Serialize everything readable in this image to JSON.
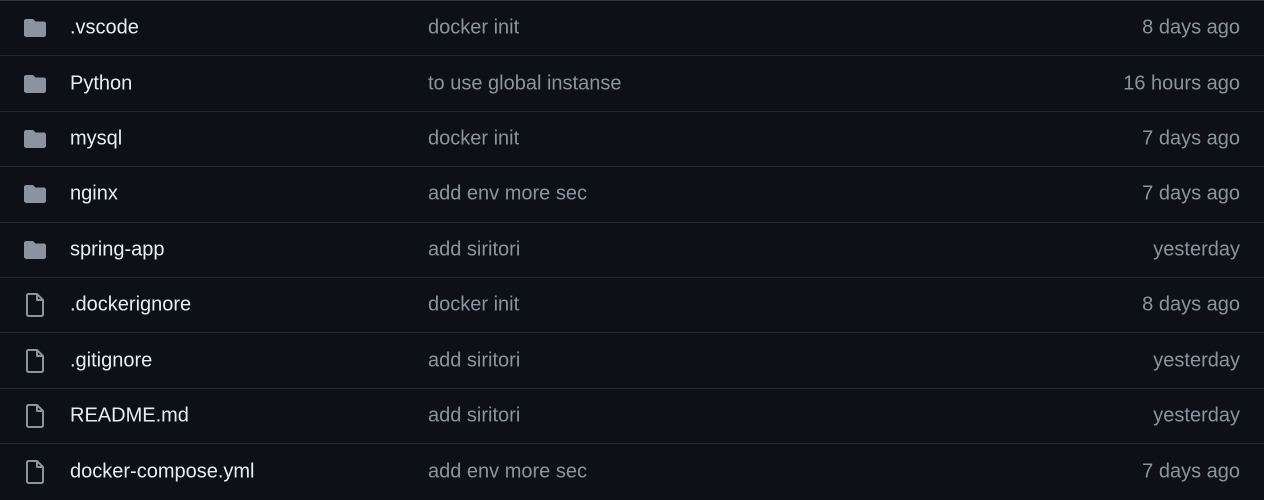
{
  "colors": {
    "background": "#0d1117",
    "name_text": "#e6edf3",
    "muted_text": "#8b949e",
    "icon": "#8b949e",
    "row_border": "#21262d"
  },
  "files": [
    {
      "type": "folder",
      "icon": "folder-icon",
      "name": ".vscode",
      "commit": "docker init",
      "age": "8 days ago"
    },
    {
      "type": "folder",
      "icon": "folder-icon",
      "name": "Python",
      "commit": "to use global instanse",
      "age": "16 hours ago"
    },
    {
      "type": "folder",
      "icon": "folder-icon",
      "name": "mysql",
      "commit": "docker init",
      "age": "7 days ago"
    },
    {
      "type": "folder",
      "icon": "folder-icon",
      "name": "nginx",
      "commit": "add env more sec",
      "age": "7 days ago"
    },
    {
      "type": "folder",
      "icon": "folder-icon",
      "name": "spring-app",
      "commit": "add siritori",
      "age": "yesterday"
    },
    {
      "type": "file",
      "icon": "file-icon",
      "name": ".dockerignore",
      "commit": "docker init",
      "age": "8 days ago"
    },
    {
      "type": "file",
      "icon": "file-icon",
      "name": ".gitignore",
      "commit": "add siritori",
      "age": "yesterday"
    },
    {
      "type": "file",
      "icon": "file-icon",
      "name": "README.md",
      "commit": "add siritori",
      "age": "yesterday"
    },
    {
      "type": "file",
      "icon": "file-icon",
      "name": "docker-compose.yml",
      "commit": "add env more sec",
      "age": "7 days ago"
    }
  ]
}
